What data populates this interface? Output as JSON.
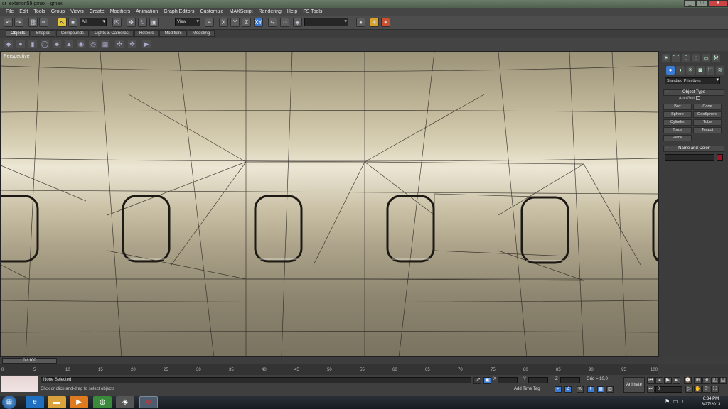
{
  "window": {
    "title": "cr_exteriorj59.gmax - gmax"
  },
  "menu": [
    "File",
    "Edit",
    "Tools",
    "Group",
    "Views",
    "Create",
    "Modifiers",
    "Animation",
    "Graph Editors",
    "Customize",
    "MAXScript",
    "Rendering",
    "Help",
    "FS Tools"
  ],
  "toolbar": {
    "selection_filter": "All",
    "reference_coord": "View"
  },
  "tabs": [
    "Objects",
    "Shapes",
    "Compounds",
    "Lights & Cameras",
    "Helpers",
    "Modifiers",
    "Modeling"
  ],
  "active_tab": "Objects",
  "viewport": {
    "label": "Perspective"
  },
  "command_panel": {
    "category": "Standard Primitives",
    "object_type_title": "Object Type",
    "autogrid_label": "AutoGrid",
    "buttons": [
      "Box",
      "Cone",
      "Sphere",
      "GeoSphere",
      "Cylinder",
      "Tube",
      "Torus",
      "Teapot",
      "Plane"
    ],
    "name_color_title": "Name and Color",
    "color": "#a0132a"
  },
  "timeline": {
    "slider_label": "0 / 100",
    "ticks": [
      "0",
      "5",
      "10",
      "15",
      "20",
      "25",
      "30",
      "35",
      "40",
      "45",
      "50",
      "55",
      "60",
      "65",
      "70",
      "75",
      "80",
      "85",
      "90",
      "95",
      "100"
    ]
  },
  "status": {
    "selection": "None Selected",
    "prompt": "Click or click-and-drag to select objects",
    "x_label": "X",
    "y_label": "Y",
    "z_label": "Z",
    "grid": "Grid = 10.0",
    "add_time_tag": "Add Time Tag",
    "animate": "Animate",
    "frame": "0"
  },
  "taskbar": {
    "time": "6:34 PM",
    "date": "8/27/2013"
  }
}
